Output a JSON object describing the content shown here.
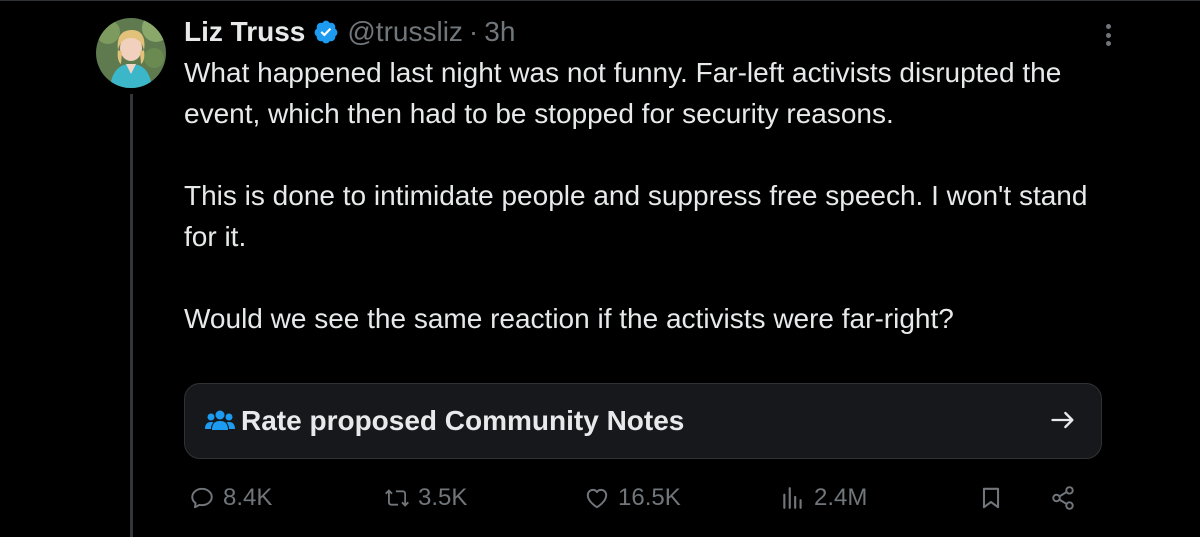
{
  "author": {
    "name": "Liz Truss",
    "handle": "@trussliz",
    "separator": "·",
    "time": "3h"
  },
  "tweet": {
    "paragraphs": [
      "What happened last night was not funny. Far-left activists disrupted the event, which then had to be stopped for security reasons.",
      "This is done to intimidate people and suppress free speech. I won't stand for it.",
      "Would we see the same reaction if the activists were far-right?"
    ]
  },
  "community_notes": {
    "label": "Rate proposed Community Notes",
    "icon": "people-icon",
    "arrow": "→"
  },
  "actions": {
    "replies": "8.4K",
    "reposts": "3.5K",
    "likes": "16.5K",
    "views": "2.4M"
  },
  "colors": {
    "background": "#000000",
    "text": "#e7e9ea",
    "muted": "#71767b",
    "verified": "#1d9bf0",
    "card": "#16181c",
    "border": "#2f3336"
  }
}
